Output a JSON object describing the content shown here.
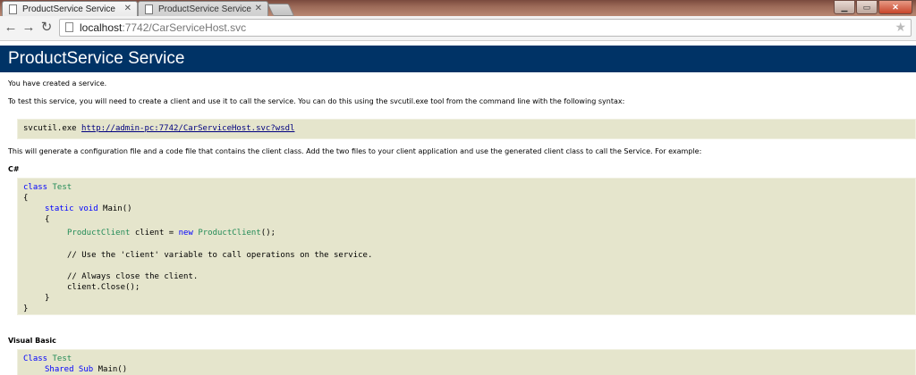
{
  "browser": {
    "tabs": [
      {
        "title": "ProductService Service",
        "active": true
      },
      {
        "title": "ProductService Service",
        "active": false
      }
    ],
    "url_host": "localhost",
    "url_rest": ":7742/CarServiceHost.svc"
  },
  "page": {
    "heading": "ProductService Service",
    "p1": "You have created a service.",
    "p2": "To test this service, you will need to create a client and use it to call the service. You can do this using the svcutil.exe tool from the command line with the following syntax:",
    "svcutil_cmd": "svcutil.exe ",
    "svcutil_link": "http://admin-pc:7742/CarServiceHost.svc?wsdl",
    "p3": "This will generate a configuration file and a code file that contains the client class. Add the two files to your client application and use the generated client class to call the Service. For example:",
    "csharp_label": "C#",
    "vb_label": "Visual Basic",
    "csharp": {
      "l1_kw": "class",
      "l1_ty": "Test",
      "l2": "{",
      "l3_kw1": "static",
      "l3_kw2": "void",
      "l3_rest": " Main()",
      "l4": "{",
      "l5_ty": "ProductClient",
      "l5_mid": " client = ",
      "l5_kw": "new",
      "l5_ty2": "ProductClient",
      "l5_end": "();",
      "l6": "// Use the 'client' variable to call operations on the service.",
      "l7": "// Always close the client.",
      "l8": "client.Close();",
      "l9": "}",
      "l10": "}"
    },
    "vb": {
      "l1_kw": "Class",
      "l1_ty": "Test",
      "l2_kw": "Shared Sub",
      "l2_rest": " Main()"
    }
  }
}
